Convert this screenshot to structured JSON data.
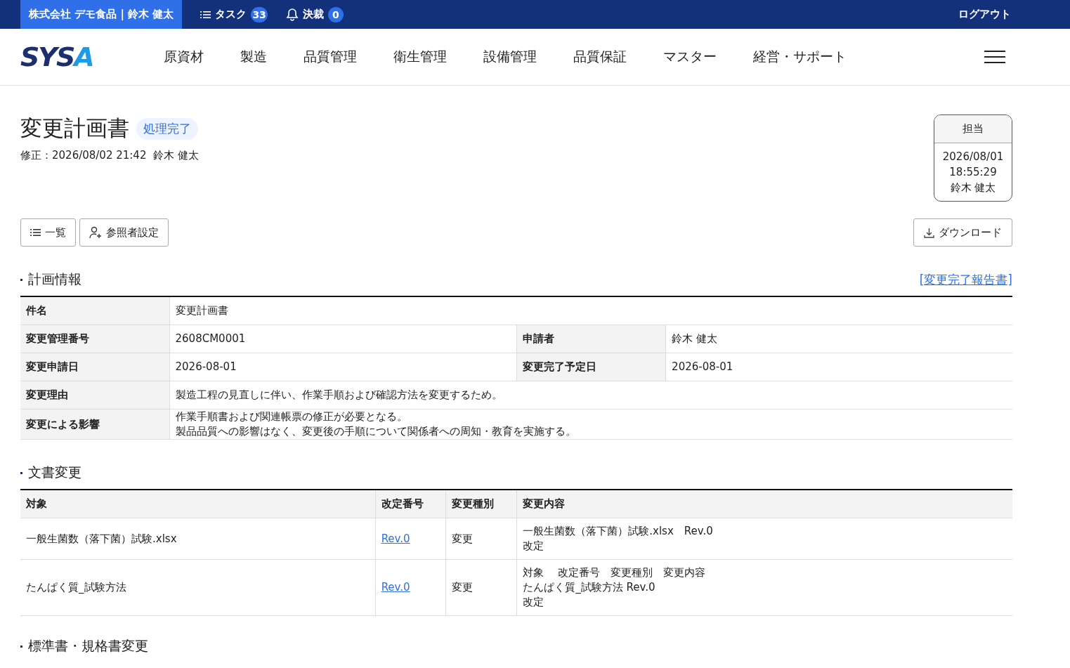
{
  "topbar": {
    "user": "株式会社 デモ食品 | 鈴木 健太",
    "items": [
      {
        "kind": "tasks",
        "label": "タスク",
        "count": "33"
      },
      {
        "kind": "approvals",
        "label": "決裁",
        "count": "0"
      }
    ],
    "logout": "ログアウト"
  },
  "logo": {
    "dark": "SYS",
    "light": "A"
  },
  "nav": [
    "原資材",
    "製造",
    "品質管理",
    "衛生管理",
    "設備管理",
    "品質保証",
    "マスター",
    "経営・サポート"
  ],
  "page": {
    "title": "変更計画書",
    "status": "処理完了",
    "modified": "修正：2026/08/02 21:42  鈴木 健太"
  },
  "assignee": {
    "label": "担当",
    "lines": [
      "2026/08/01",
      "18:55:29",
      "鈴木 健太"
    ]
  },
  "actions": {
    "left": [
      {
        "kind": "list",
        "label": "一覧"
      },
      {
        "kind": "user-add",
        "label": "参照者設定"
      }
    ],
    "download": "ダウンロード"
  },
  "plan_info": {
    "title": "計画情報",
    "link": "[変更完了報告書]",
    "rows": [
      {
        "cells": [
          {
            "label": "件名",
            "value": [
              "変更計画書"
            ]
          }
        ]
      },
      {
        "cells": [
          {
            "label": "変更管理番号",
            "value": [
              "2608CM0001"
            ]
          },
          {
            "label": "申請者",
            "value": [
              "鈴木 健太"
            ]
          }
        ]
      },
      {
        "cells": [
          {
            "label": "変更申請日",
            "value": [
              "2026-08-01"
            ]
          },
          {
            "label": "変更完了予定日",
            "value": [
              "2026-08-01"
            ]
          }
        ]
      },
      {
        "cells": [
          {
            "label": "変更理由",
            "value": [
              "製造工程の見直しに伴い、作業手順および確認方法を変更するため。"
            ]
          }
        ]
      },
      {
        "cells": [
          {
            "label": "変更による影響",
            "value": [
              "作業手順書および関連帳票の修正が必要となる。",
              "製品品質への影響はなく、変更後の手順について関係者への周知・教育を実施する。"
            ]
          }
        ]
      }
    ]
  },
  "doc_changes": {
    "title": "文書変更",
    "columns": [
      "対象",
      "改定番号",
      "変更種別",
      "変更内容"
    ],
    "rows": [
      {
        "target": "一般生菌数（落下菌）試験.xlsx",
        "revision": "Rev.0",
        "type": "変更",
        "content": [
          "一般生菌数（落下菌）試験.xlsx　Rev.0",
          "改定"
        ]
      },
      {
        "target": "たんぱく質_試験方法",
        "revision": "Rev.0",
        "type": "変更",
        "content": [
          "対象　 改定番号　変更種別　変更内容",
          "たんぱく質_試験方法 Rev.0",
          "改定"
        ]
      }
    ]
  },
  "next_section": {
    "title": "標準書・規格書変更"
  }
}
